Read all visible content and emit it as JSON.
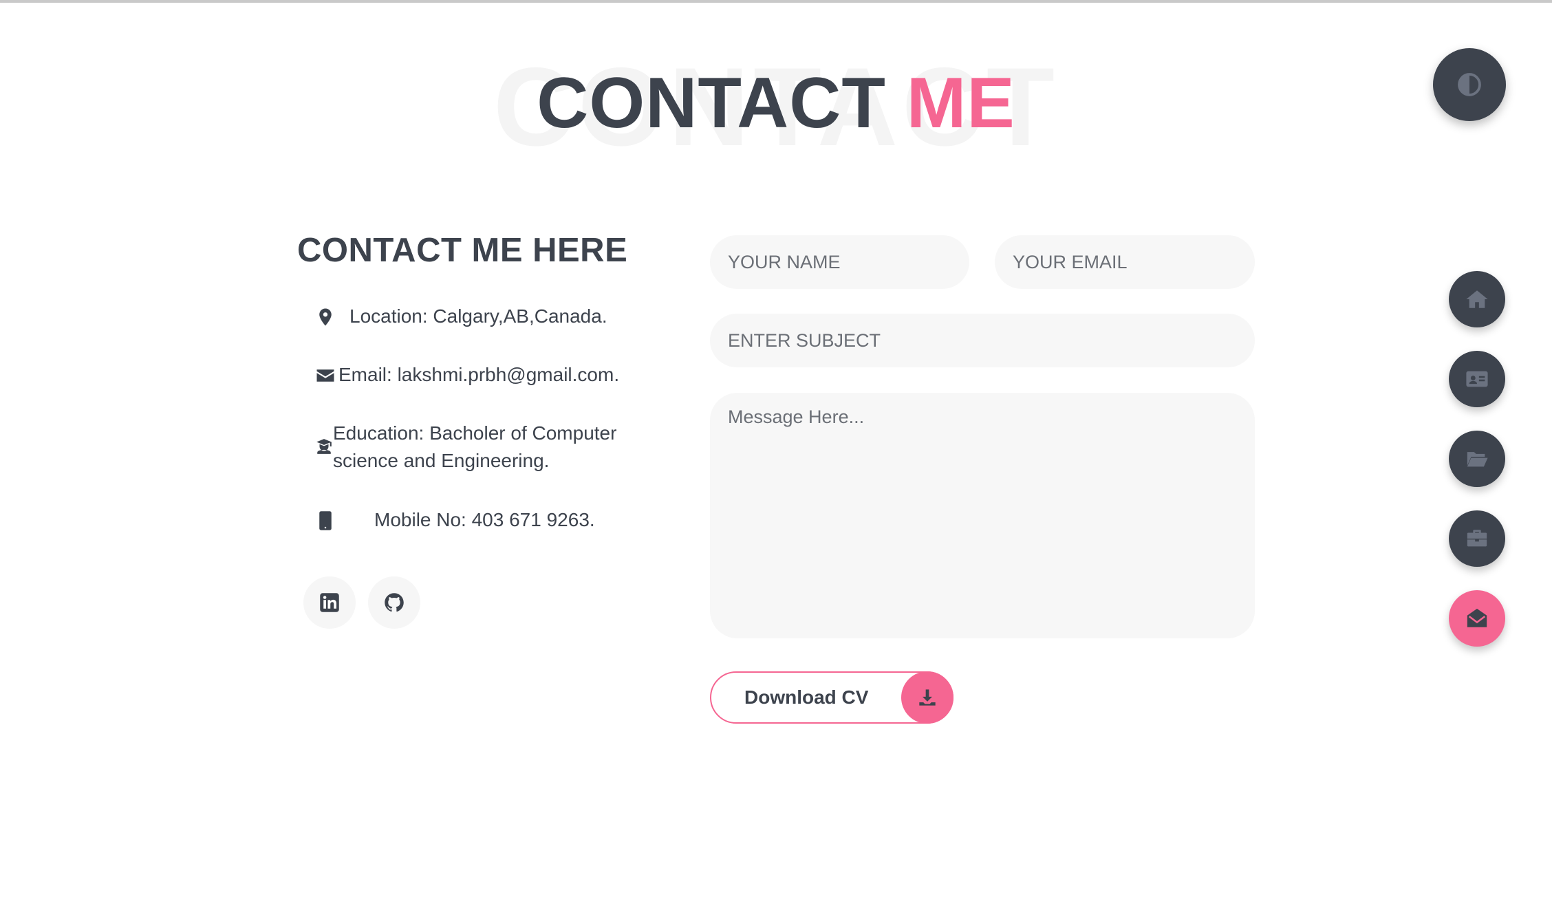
{
  "title": {
    "background_text": "CONTACT",
    "main": "CONTACT",
    "accent": "ME"
  },
  "contact": {
    "heading": "CONTACT ME HERE",
    "location": "Location: Calgary,AB,Canada.",
    "email": "Email: lakshmi.prbh@gmail.com.",
    "education": "Education: Bacholer of Computer science and Engineering.",
    "mobile": "Mobile No: 403 671 9263.",
    "socials": [
      {
        "icon": "linkedin-icon"
      },
      {
        "icon": "github-icon"
      }
    ]
  },
  "form": {
    "name_placeholder": "YOUR NAME",
    "email_placeholder": "YOUR EMAIL",
    "subject_placeholder": "ENTER SUBJECT",
    "message_placeholder": "Message Here...",
    "download_label": "Download CV"
  },
  "nav": {
    "theme_icon": "contrast-icon",
    "items": [
      {
        "icon": "home-icon",
        "active": false
      },
      {
        "icon": "id-card-icon",
        "active": false
      },
      {
        "icon": "folder-open-icon",
        "active": false
      },
      {
        "icon": "briefcase-icon",
        "active": false
      },
      {
        "icon": "envelope-open-icon",
        "active": true
      }
    ]
  },
  "colors": {
    "accent": "#f56692",
    "dark": "#3d434d",
    "field_bg": "#f7f7f7"
  }
}
